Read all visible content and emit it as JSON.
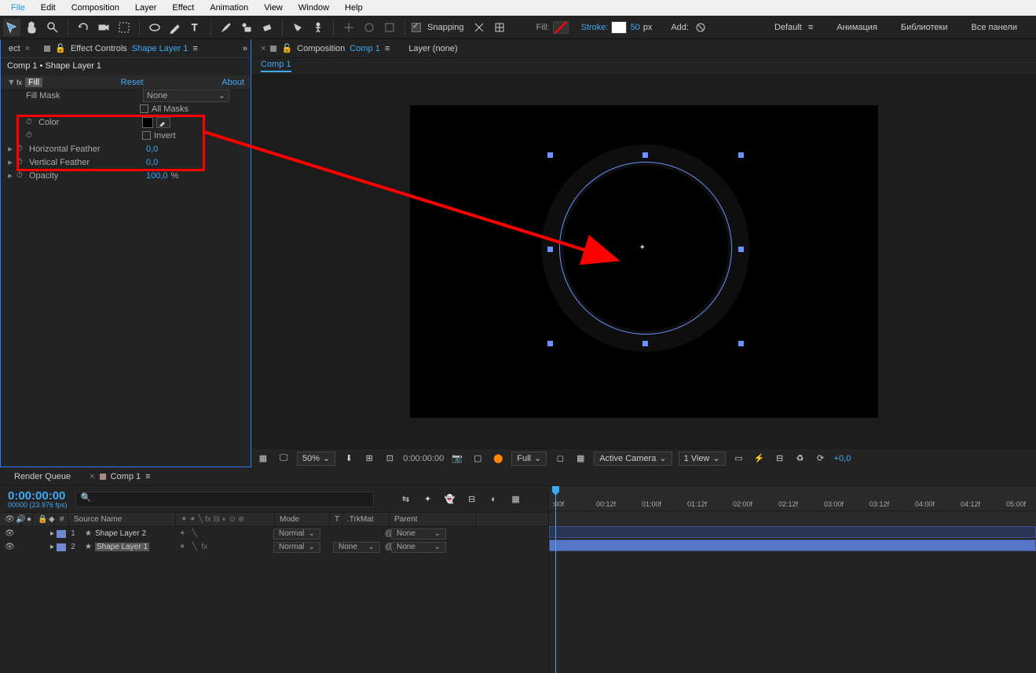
{
  "menu": {
    "items": [
      "File",
      "Edit",
      "Composition",
      "Layer",
      "Effect",
      "Animation",
      "View",
      "Window",
      "Help"
    ]
  },
  "toolbar": {
    "snapping": "Snapping",
    "fill_lbl": "Fill:",
    "stroke_lbl": "Stroke:",
    "stroke_val": "50",
    "stroke_unit": "px",
    "add_lbl": "Add:",
    "workspaces": [
      "Default",
      "Анимация",
      "Библиотеки",
      "Все панели"
    ]
  },
  "effect_panel": {
    "tab_prefix": "ect",
    "tab_label": "Effect Controls",
    "tab_layer": "Shape Layer 1",
    "crumb": "Comp 1 • Shape Layer 1",
    "fx_name": "Fill",
    "reset": "Reset",
    "about": "About",
    "rows": {
      "fill_mask": "Fill Mask",
      "fill_mask_val": "None",
      "all_masks": "All Masks",
      "color": "Color",
      "invert": "Invert",
      "hfeather": "Horizontal Feather",
      "hfeather_val": "0,0",
      "vfeather": "Vertical Feather",
      "vfeather_val": "0,0",
      "opacity": "Opacity",
      "opacity_val": "100,0",
      "opacity_unit": "%"
    }
  },
  "viewer": {
    "comp_tab": "Composition",
    "comp_name": "Comp 1",
    "layer_tab": "Layer (none)",
    "subtab": "Comp 1"
  },
  "vfoot": {
    "zoom": "50%",
    "time": "0:00:00:00",
    "res": "Full",
    "camera": "Active Camera",
    "view": "1 View",
    "exp": "+0,0"
  },
  "timeline": {
    "tab_rq": "Render Queue",
    "tab_comp": "Comp 1",
    "timecode": "0:00:00:00",
    "fps": "00000 (23.976 fps)",
    "cols": {
      "n": "#",
      "src": "Source Name",
      "mode": "Mode",
      "t": "T",
      "trkmat": ".TrkMat",
      "parent": "Parent"
    },
    "layers": [
      {
        "n": "1",
        "name": "Shape Layer 2",
        "mode": "Normal",
        "trkmat": "",
        "parent": "None"
      },
      {
        "n": "2",
        "name": "Shape Layer 1",
        "mode": "Normal",
        "trkmat": "None",
        "parent": "None"
      }
    ],
    "ticks": [
      ":00f",
      "00:12f",
      "01:00f",
      "01:12f",
      "02:00f",
      "02:12f",
      "03:00f",
      "03:12f",
      "04:00f",
      "04:12f",
      "05:00f"
    ]
  }
}
